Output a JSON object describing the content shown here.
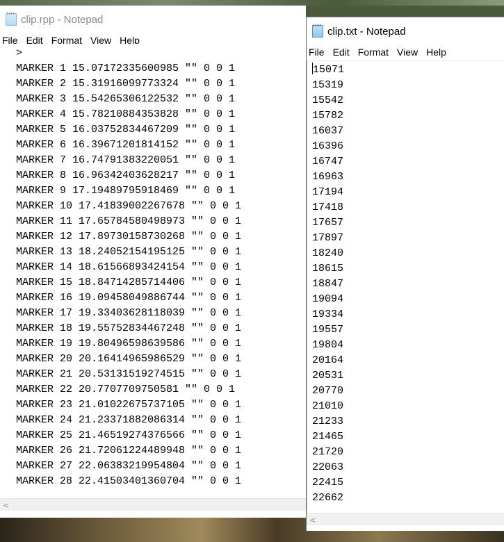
{
  "left_window": {
    "title": "clip.rpp - Notepad",
    "menu": [
      "File",
      "Edit",
      "Format",
      "View",
      "Help"
    ],
    "lines": [
      ">",
      "MARKER 1 15.07172335600985 \"\" 0 0 1",
      "MARKER 2 15.31916099773324 \"\" 0 0 1",
      "MARKER 3 15.54265306122532 \"\" 0 0 1",
      "MARKER 4 15.78210884353828 \"\" 0 0 1",
      "MARKER 5 16.03752834467209 \"\" 0 0 1",
      "MARKER 6 16.39671201814152 \"\" 0 0 1",
      "MARKER 7 16.74791383220051 \"\" 0 0 1",
      "MARKER 8 16.96342403628217 \"\" 0 0 1",
      "MARKER 9 17.19489795918469 \"\" 0 0 1",
      "MARKER 10 17.41839002267678 \"\" 0 0 1",
      "MARKER 11 17.65784580498973 \"\" 0 0 1",
      "MARKER 12 17.89730158730268 \"\" 0 0 1",
      "MARKER 13 18.24052154195125 \"\" 0 0 1",
      "MARKER 14 18.61566893424154 \"\" 0 0 1",
      "MARKER 15 18.84714285714406 \"\" 0 0 1",
      "MARKER 16 19.09458049886744 \"\" 0 0 1",
      "MARKER 17 19.33403628118039 \"\" 0 0 1",
      "MARKER 18 19.55752834467248 \"\" 0 0 1",
      "MARKER 19 19.80496598639586 \"\" 0 0 1",
      "MARKER 20 20.16414965986529 \"\" 0 0 1",
      "MARKER 21 20.53131519274515 \"\" 0 0 1",
      "MARKER 22 20.7707709750581 \"\" 0 0 1",
      "MARKER 23 21.01022675737105 \"\" 0 0 1",
      "MARKER 24 21.23371882086314 \"\" 0 0 1",
      "MARKER 25 21.46519274376566 \"\" 0 0 1",
      "MARKER 26 21.72061224489948 \"\" 0 0 1",
      "MARKER 27 22.06383219954804 \"\" 0 0 1",
      "MARKER 28 22.41503401360704 \"\" 0 0 1"
    ]
  },
  "right_window": {
    "title": "clip.txt - Notepad",
    "menu": [
      "File",
      "Edit",
      "Format",
      "View",
      "Help"
    ],
    "lines": [
      "15071",
      "15319",
      "15542",
      "15782",
      "16037",
      "16396",
      "16747",
      "16963",
      "17194",
      "17418",
      "17657",
      "17897",
      "18240",
      "18615",
      "18847",
      "19094",
      "19334",
      "19557",
      "19804",
      "20164",
      "20531",
      "20770",
      "21010",
      "21233",
      "21465",
      "21720",
      "22063",
      "22415",
      "22662"
    ]
  },
  "icons": {
    "app": "notepad-icon",
    "scroll_left": "chevron-left-icon",
    "scroll_left_glyph": "<"
  }
}
